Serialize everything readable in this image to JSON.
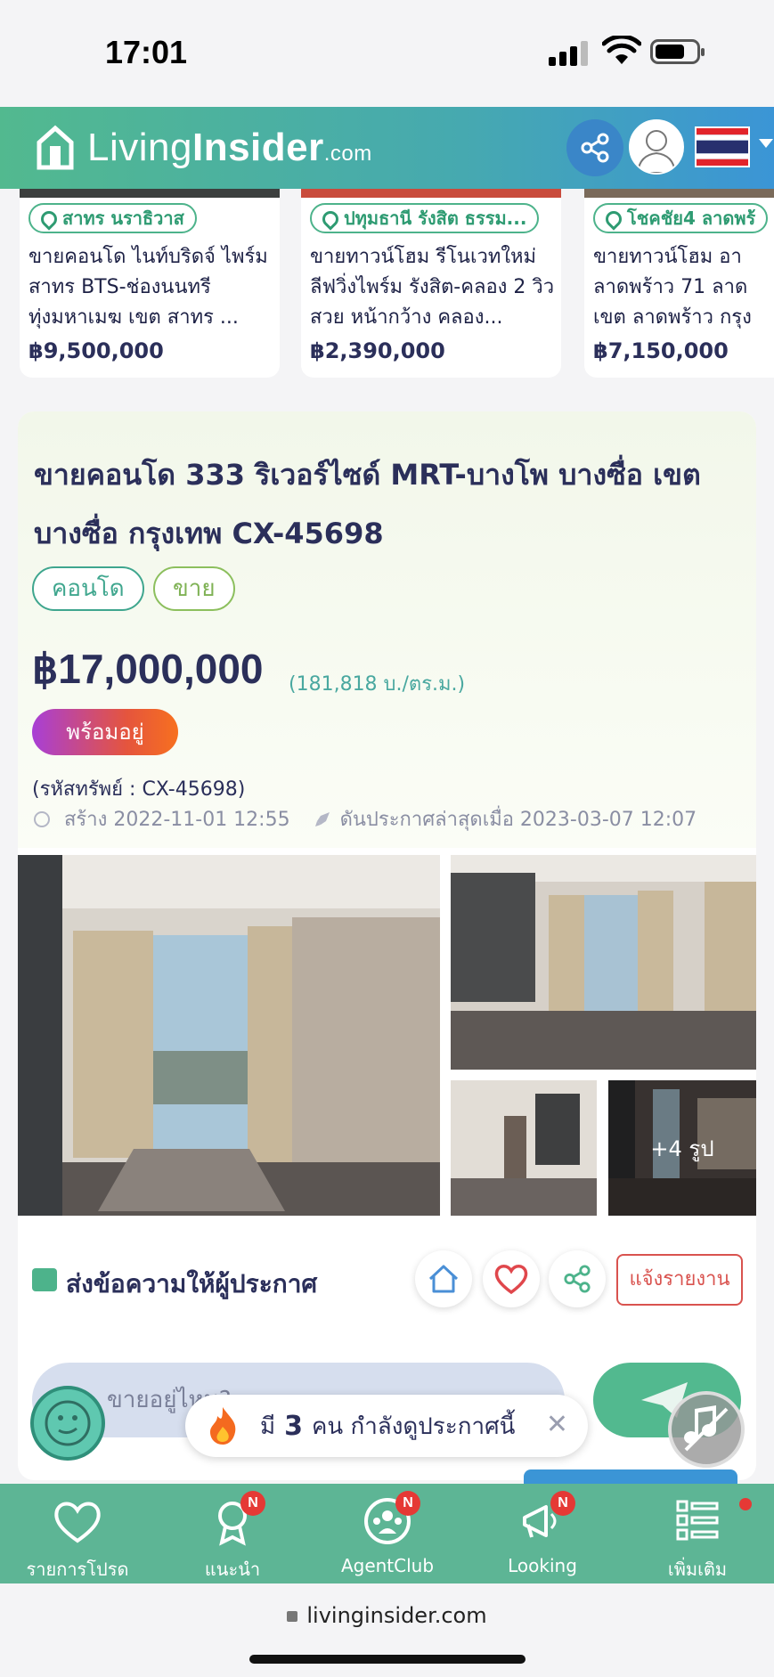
{
  "status": {
    "time": "17:01"
  },
  "header": {
    "logo": {
      "prefix": "Living",
      "bold": "Insider",
      "suffix": ".com"
    },
    "share_icon": "share-icon",
    "avatar_icon": "user-avatar-icon",
    "flag": "thailand-flag"
  },
  "carousel": [
    {
      "location": "สาทร นราธิวาส",
      "title": "ขายคอนโด ไนท์บริดจ์ ไพร์ม สาทร BTS-ช่องนนทรี ทุ่งมหาเมฆ เขต สาทร ...",
      "price": "฿9,500,000"
    },
    {
      "location": "ปทุมธานี รังสิต ธรรม...",
      "title": "ขายทาวน์โฮม รีโนเวทใหม่ ลีฟวิ่งไพร์ม รังสิต-คลอง 2 วิวสวย หน้ากว้าง คลอง...",
      "price": "฿2,390,000"
    },
    {
      "location": "โชคชัย4 ลาดพร้",
      "title": "ขายทาวน์โฮม อา ลาดพร้าว 71 ลาด เขต ลาดพร้าว กรุง",
      "price": "฿7,150,000"
    }
  ],
  "listing": {
    "title": "ขายคอนโด 333 ริเวอร์ไซด์ MRT-บางโพ บางซื่อ เขต บางซื่อ กรุงเทพ CX-45698",
    "chips": [
      "คอนโด",
      "ขาย"
    ],
    "price": "฿17,000,000",
    "price_per_sqm": "(181,818 บ./ตร.ม.)",
    "ready_badge": "พร้อมอยู่",
    "code": "(รหัสทรัพย์ : CX-45698)",
    "created": "สร้าง 2022-11-01 12:55",
    "bumped": "ดันประกาศล่าสุดเมื่อ 2023-03-07 12:07",
    "more_photos": "+4 รูป"
  },
  "message": {
    "title": "ส่งข้อความให้ผู้ประกาศ",
    "report": "แจ้งรายงาน",
    "input_placeholder": "ขายอยู่ไหม?"
  },
  "viewers": {
    "prefix": "มี",
    "count": "3",
    "suffix": "คน กำลังดูประกาศนี้",
    "close": "✕"
  },
  "bottom_nav": [
    {
      "label": "รายการโปรด",
      "icon": "heart-icon",
      "badge": ""
    },
    {
      "label": "แนะนำ",
      "icon": "award-icon",
      "badge": "N"
    },
    {
      "label": "AgentClub",
      "icon": "group-icon",
      "badge": "N"
    },
    {
      "label": "Looking",
      "icon": "megaphone-icon",
      "badge": "N"
    },
    {
      "label": "เพิ่มเติม",
      "icon": "menu-icon",
      "badge": ""
    }
  ],
  "browser": {
    "url": "livinginsider.com"
  },
  "colors": {
    "brand_green": "#52b98f",
    "brand_blue": "#3b95d6",
    "navy": "#2b2f5a",
    "alert_red": "#e53935"
  }
}
